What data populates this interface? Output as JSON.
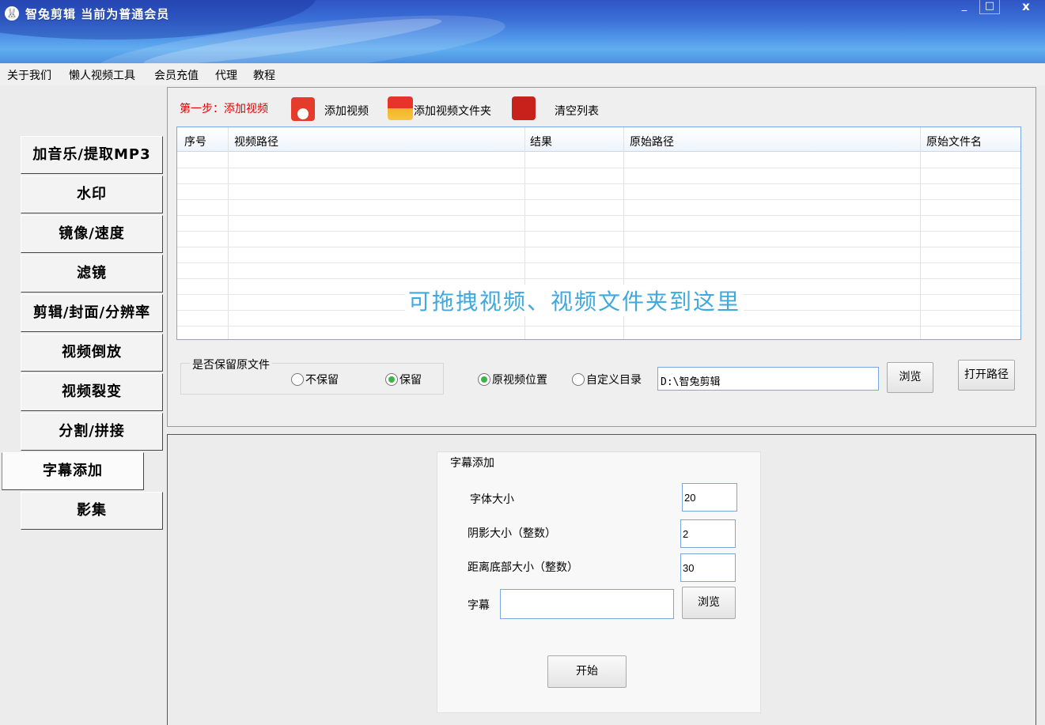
{
  "window": {
    "title": "智兔剪辑  当前为普通会员",
    "min_glyph": "_",
    "max_glyph": "□",
    "close_glyph": "x"
  },
  "menu": [
    "关于我们",
    "懒人视频工具",
    "会员充值",
    "代理",
    "教程"
  ],
  "nav": {
    "items": [
      "加音乐/提取MP3",
      "水印",
      "镜像/速度",
      "滤镜",
      "剪辑/封面/分辨率",
      "视频倒放",
      "视频裂变",
      "分割/拼接",
      "字幕添加",
      "影集"
    ],
    "active": "字幕添加"
  },
  "toolbar": {
    "step": "第一步：添加视频",
    "add_video": "添加视频",
    "add_folder": "添加视频文件夹",
    "clear_list": "清空列表"
  },
  "table": {
    "columns": [
      "序号",
      "视频路径",
      "结果",
      "原始路径",
      "原始文件名"
    ],
    "rows": [],
    "drop_hint": "可拖拽视频、视频文件夹到这里"
  },
  "options": {
    "keep_original_label": "是否保留原文件",
    "no_keep": "不保留",
    "keep": "保留",
    "keep_selected": "保留",
    "orig_location": "原视频位置",
    "custom_dir": "自定义目录",
    "location_selected": "原视频位置",
    "output_path": "D:\\智兔剪辑",
    "browse": "浏览",
    "open_path": "打开路径"
  },
  "subtitle_panel": {
    "group_title": "字幕添加",
    "font_size_label": "字体大小",
    "font_size_value": "20",
    "shadow_label": "阴影大小（整数）",
    "shadow_value": "2",
    "bottom_margin_label": "距离底部大小（整数）",
    "bottom_margin_value": "30",
    "subtitle_label": "字幕",
    "subtitle_value": "",
    "browse": "浏览",
    "start": "开始"
  },
  "colors": {
    "titlebar": "#3a6ed6",
    "step_label": "#e00000",
    "drop_hint": "#3fa9de",
    "radio_on": "#3bb54a",
    "input_border": "#7aa7e0"
  }
}
